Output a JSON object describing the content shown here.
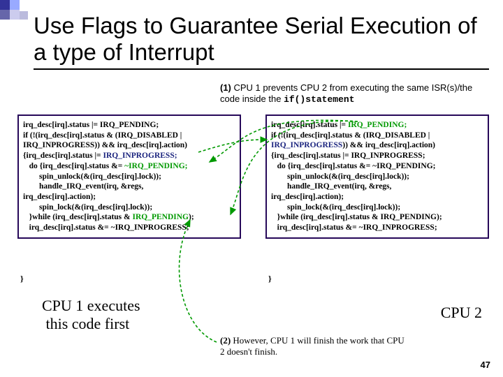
{
  "title": "Use Flags to Guarantee Serial Execution of a type of Interrupt",
  "caption1": {
    "num": "(1)",
    "text_a": " CPU 1 prevents CPU 2 from executing the same ISR(s)/the code inside the ",
    "code": "if()statement"
  },
  "code_left": {
    "l1": "irq_desc[irq].status |= IRQ_PENDING;",
    "l2": "if (!(irq_desc[irq].status & (IRQ_DISABLED |",
    "l3": "IRQ_INPROGRESS)) && irq_desc[irq].action)",
    "l4a": "{irq_desc[irq].status |= ",
    "l4b": "IRQ_INPROGRESS;",
    "l5a": "   do {irq_desc[irq].status &= ",
    "l5b": "~IRQ_PENDING;",
    "l6": "        spin_unlock(&(irq_desc[irq].lock));",
    "l7": "        handle_IRQ_event(irq, &regs,",
    "l8": "irq_desc[irq].action);",
    "l9": "        spin_lock(&(irq_desc[irq].lock));",
    "l10a": "   }while (irq_desc[irq].status & ",
    "l10b": "IRQ_PENDING",
    "l10c": ");",
    "l11": "   irq_desc[irq].status &= ~IRQ_INPROGRESS;"
  },
  "code_right": {
    "l1a": "irq_desc[irq].status |= ",
    "l1b": "IRQ_PENDING;",
    "l2": "if (!(irq_desc[irq].status & (IRQ_DISABLED |",
    "l3a": "",
    "l3b": "IRQ_INPROGRESS",
    "l3c": ")) && irq_desc[irq].action)",
    "l4": "{irq_desc[irq].status |= IRQ_INPROGRESS;",
    "l5": "   do {irq_desc[irq].status &= ~IRQ_PENDING;",
    "l6": "        spin_unlock(&(irq_desc[irq].lock));",
    "l7": "        handle_IRQ_event(irq, &regs,",
    "l8": "irq_desc[irq].action);",
    "l9": "        spin_lock(&(irq_desc[irq].lock));",
    "l10": "   }while (irq_desc[irq].status & IRQ_PENDING);",
    "l11": "   irq_desc[irq].status &= ~IRQ_INPROGRESS;"
  },
  "brace": "}",
  "cpu1_label": "CPU 1 executes\nthis code first",
  "cpu2_label": "CPU 2",
  "caption2": {
    "num": "(2)",
    "text": " However, CPU 1 will finish the work that CPU 2 doesn't finish."
  },
  "slide_num": "47"
}
